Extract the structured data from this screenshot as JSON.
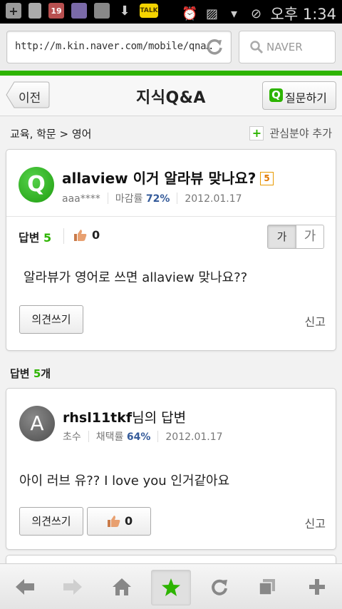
{
  "status_bar": {
    "time": "오후 1:34",
    "notification_badge": "19",
    "talk_label": "TALK"
  },
  "browser": {
    "url": "http://m.kin.naver.com/mobile/qna…",
    "search_placeholder": "NAVER"
  },
  "header": {
    "back_label": "이전",
    "title": "지식Q&A",
    "ask_icon": "Q",
    "ask_label": "질문하기"
  },
  "category": {
    "breadcrumb": "교육, 학문 > 영어",
    "add_interest_label": "관심분야 추가"
  },
  "question": {
    "avatar_letter": "Q",
    "title": "allaview 이거 알라뷰 맞나요?",
    "badge": "5",
    "user": "aaa****",
    "close_rate_label": "마감률",
    "close_rate": "72%",
    "date": "2012.01.17",
    "answers_label": "답변",
    "answers_count": "5",
    "likes": "0",
    "font_small": "가",
    "font_large": "가",
    "body": "알라뷰가 영어로 쓰면 allaview 맞나요??",
    "comment_button": "의견쓰기",
    "report_label": "신고"
  },
  "answers_section": {
    "heading_prefix": "답변 ",
    "count": "5",
    "suffix": "개"
  },
  "answer": {
    "avatar_letter": "A",
    "username": "rhsl11tkf",
    "title_suffix": "님의 답변",
    "rank": "초수",
    "adopt_rate_label": "채택률",
    "adopt_rate": "64%",
    "date": "2012.01.17",
    "body": "아이 러브 유?? I love you 인거같아요",
    "comment_button": "의견쓰기",
    "likes": "0",
    "report_label": "신고"
  },
  "toolbar": {
    "items": [
      "back-arrow-icon",
      "forward-arrow-icon",
      "home-icon",
      "bookmark-star-icon",
      "refresh-icon",
      "windows-icon",
      "add-icon"
    ]
  },
  "colors": {
    "naver_green": "#2db400",
    "rate_blue": "#355b9a",
    "badge_orange": "#e07800"
  }
}
